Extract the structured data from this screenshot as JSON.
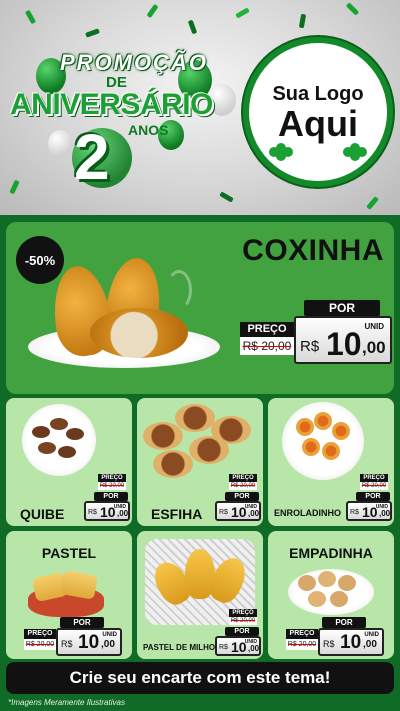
{
  "header": {
    "promo_line1": "PROMOÇÃO",
    "promo_line2": "DE",
    "promo_line3": "ANIVERSÁRIO",
    "promo_number": "2",
    "promo_unit": "ANOS",
    "logo_line1": "Sua Logo",
    "logo_line2": "Aqui"
  },
  "featured": {
    "discount": "-50%",
    "name": "COXINHA",
    "por": "POR",
    "preco": "PREÇO",
    "old_price": "R$ 20,00",
    "currency": "R$",
    "price_int": "10",
    "price_dec": ",00",
    "unit": "UNID"
  },
  "products": [
    {
      "name": "QUIBE",
      "por": "POR",
      "preco": "PREÇO",
      "old_price": "R$ 20,00",
      "currency": "R$",
      "price_int": "10",
      "price_dec": ",00",
      "unit": "UNID"
    },
    {
      "name": "ESFIHA",
      "por": "POR",
      "preco": "PREÇO",
      "old_price": "R$ 20,00",
      "currency": "R$",
      "price_int": "10",
      "price_dec": ",00",
      "unit": "UNID"
    },
    {
      "name": "ENROLADINHO",
      "por": "POR",
      "preco": "PREÇO",
      "old_price": "R$ 20,00",
      "currency": "R$",
      "price_int": "10",
      "price_dec": ",00",
      "unit": "UNID"
    },
    {
      "name": "PASTEL",
      "por": "POR",
      "preco": "PREÇO",
      "old_price": "R$ 20,00",
      "currency": "R$",
      "price_int": "10",
      "price_dec": ",00",
      "unit": "UNID"
    },
    {
      "name": "PASTEL DE MILHO",
      "por": "POR",
      "preco": "PREÇO",
      "old_price": "R$ 20,00",
      "currency": "R$",
      "price_int": "10",
      "price_dec": ",00",
      "unit": "UNID"
    },
    {
      "name": "EMPADINHA",
      "por": "POR",
      "preco": "PREÇO",
      "old_price": "R$ 20,00",
      "currency": "R$",
      "price_int": "10",
      "price_dec": ",00",
      "unit": "UNID"
    }
  ],
  "footer": {
    "banner": "Crie seu encarte com este tema!",
    "note": "*Imagens Meramente Ilustrativas"
  },
  "colors": {
    "background": "#0f6b25",
    "feature_panel": "#41a23f",
    "card": "#b7e6a8",
    "brand_green": "#1aa033"
  }
}
